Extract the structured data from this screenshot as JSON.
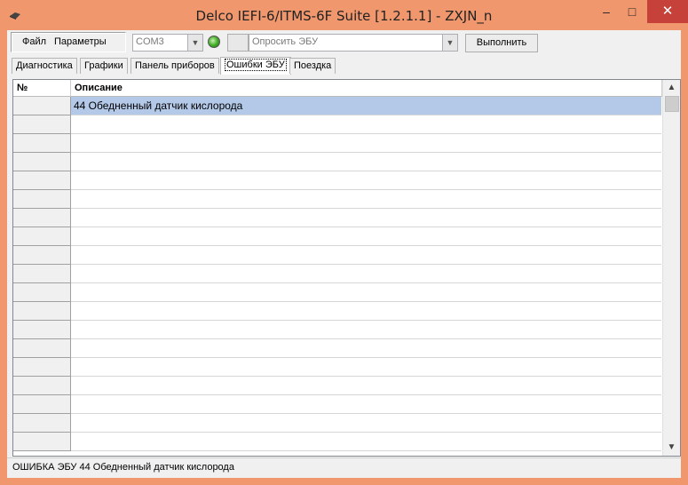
{
  "window": {
    "title": "Delco IEFI-6/ITMS-6F Suite [1.2.1.1] - ZXJN_n",
    "minimize": "–",
    "maximize": "□",
    "close": "✕"
  },
  "menu": {
    "file": "Файл",
    "settings": "Параметры"
  },
  "toolbar": {
    "port_value": "COM3",
    "ecu_query_value": "Опросить ЭБУ",
    "execute_label": "Выполнить",
    "connection_led_color": "#44b02a"
  },
  "tabs": [
    {
      "label": "Диагностика"
    },
    {
      "label": "Графики"
    },
    {
      "label": "Панель приборов"
    },
    {
      "label": "Ошибки ЭБУ",
      "active": true
    },
    {
      "label": "Поездка"
    }
  ],
  "grid": {
    "columns": {
      "num": "№",
      "description": "Описание"
    },
    "rows": [
      {
        "description": "44 Обедненный датчик кислорода",
        "selected": true
      },
      {
        "description": ""
      },
      {
        "description": ""
      },
      {
        "description": ""
      },
      {
        "description": ""
      },
      {
        "description": ""
      },
      {
        "description": ""
      },
      {
        "description": ""
      },
      {
        "description": ""
      },
      {
        "description": ""
      },
      {
        "description": ""
      },
      {
        "description": ""
      },
      {
        "description": ""
      },
      {
        "description": ""
      },
      {
        "description": ""
      },
      {
        "description": ""
      },
      {
        "description": ""
      },
      {
        "description": ""
      },
      {
        "description": ""
      }
    ]
  },
  "status": {
    "text": "ОШИБКА ЭБУ 44 Обедненный датчик кислорода"
  }
}
